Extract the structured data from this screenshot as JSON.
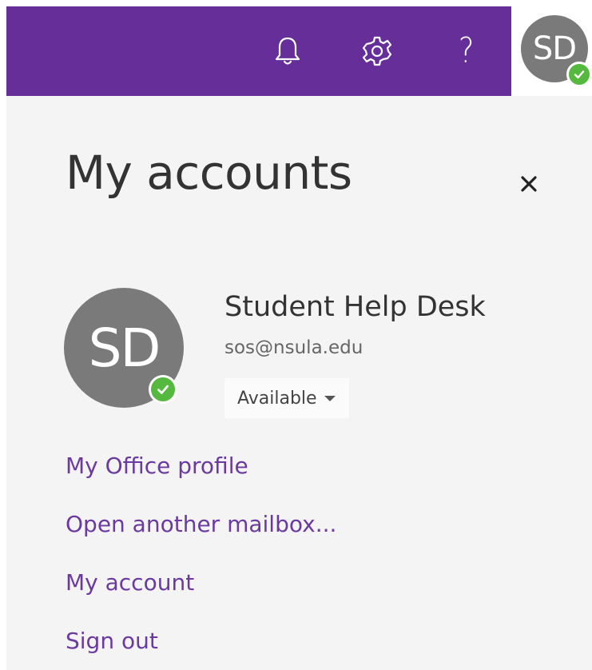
{
  "header": {
    "notifications_icon": "bell-icon",
    "settings_icon": "gear-icon",
    "help_icon": "question-mark-icon",
    "help_glyph": "?",
    "avatar_initials": "SD",
    "brand_color": "#662e99"
  },
  "panel": {
    "title": "My accounts",
    "close_icon": "close-icon",
    "user": {
      "initials": "SD",
      "name": "Student Help Desk",
      "email": "sos@nsula.edu",
      "status": "Available",
      "presence_color": "#55b83f"
    },
    "links": [
      {
        "label": "My Office profile"
      },
      {
        "label": "Open another mailbox..."
      },
      {
        "label": "My account"
      },
      {
        "label": "Sign out"
      }
    ],
    "link_color": "#6b3aa0"
  }
}
